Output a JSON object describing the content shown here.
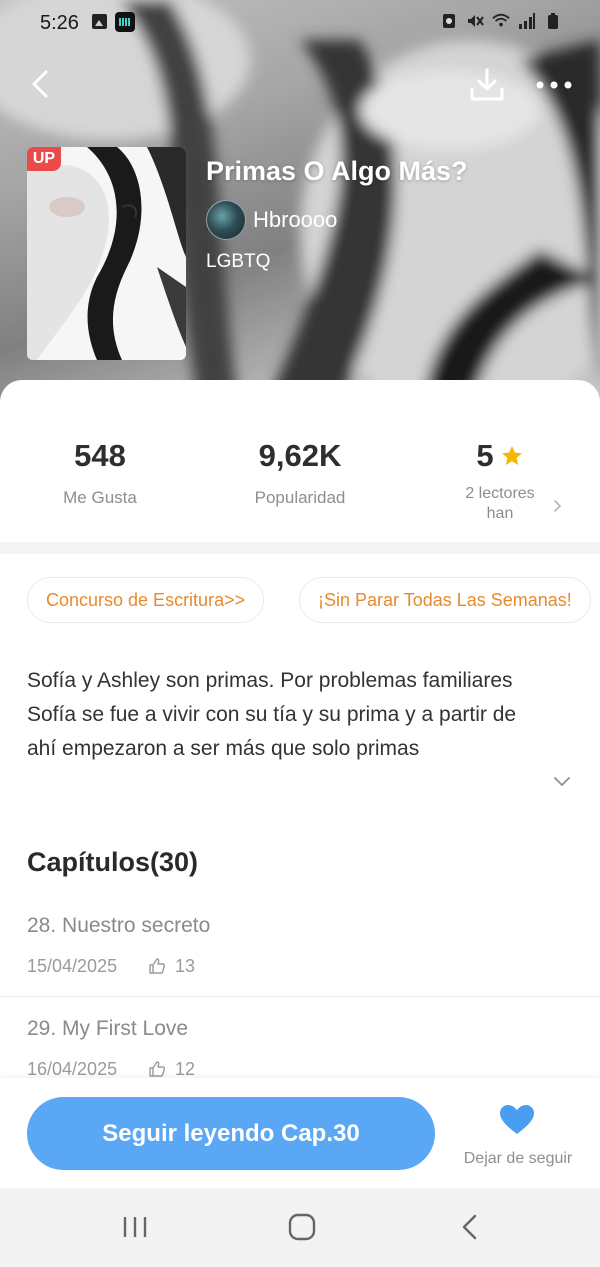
{
  "status_bar": {
    "time": "5:26",
    "left_icons": [
      "gallery-icon",
      "audio-app-icon"
    ],
    "right_icons": [
      "alarm-icon",
      "mute-icon",
      "wifi-icon",
      "signal-icon",
      "battery-icon"
    ]
  },
  "header": {
    "back_icon": "chevron-left-icon",
    "download_icon": "download-icon",
    "more_icon": "more-dots-icon"
  },
  "book": {
    "badge": "UP",
    "title": "Primas O Algo Más?",
    "author": "Hbroooo",
    "genre": "LGBTQ"
  },
  "stats": [
    {
      "value": "548",
      "label": "Me Gusta"
    },
    {
      "value": "9,62K",
      "label": "Popularidad"
    },
    {
      "value": "5",
      "label": "2 lectores han"
    }
  ],
  "tags": [
    "Concurso de Escritura>>",
    "¡Sin Parar Todas Las Semanas!"
  ],
  "synopsis": "Sofía y Ashley son primas. Por problemas familiares Sofía se fue a vivir con su tía y su prima y a partir de ahí empezaron a ser más que solo primas",
  "chapters": {
    "heading": "Capítulos(30)",
    "items": [
      {
        "title": "28. Nuestro secreto",
        "date": "15/04/2025",
        "likes": "13"
      },
      {
        "title": "29. My First Love",
        "date": "16/04/2025",
        "likes": "12"
      }
    ]
  },
  "actions": {
    "continue_label": "Seguir leyendo Cap.30",
    "unfollow_label": "Dejar de seguir"
  },
  "colors": {
    "accent_blue": "#5aa8f5",
    "tag_orange": "#e8892b",
    "badge_red": "#e94b4b",
    "star_yellow": "#f5b800"
  }
}
